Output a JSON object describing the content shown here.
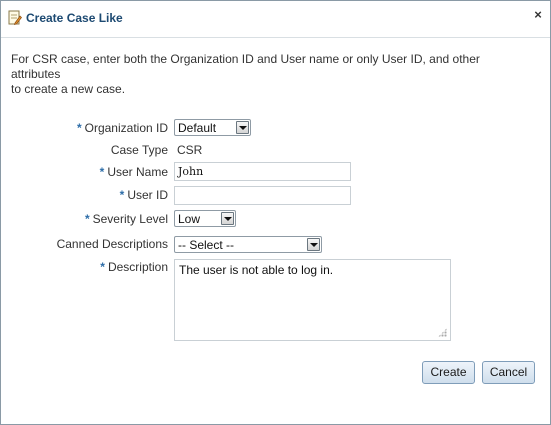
{
  "dialog": {
    "title": "Create Case Like",
    "close_glyph": "×",
    "title_icon": "document-edit-icon",
    "instructions_line1": "For CSR case, enter both the Organization ID and User name or only User ID, and other attributes",
    "instructions_line2": "to create a new case."
  },
  "form": {
    "required_marker": "*",
    "organization_id": {
      "label": "Organization ID",
      "value": "Default"
    },
    "case_type": {
      "label": "Case Type",
      "value": "CSR"
    },
    "user_name": {
      "label": "User Name",
      "value": "John"
    },
    "user_id": {
      "label": "User ID",
      "value": ""
    },
    "severity_level": {
      "label": "Severity Level",
      "value": "Low"
    },
    "canned_descriptions": {
      "label": "Canned Descriptions",
      "value": "-- Select --"
    },
    "description": {
      "label": "Description",
      "value": "The user is not able to log in."
    }
  },
  "buttons": {
    "create": "Create",
    "cancel": "Cancel"
  },
  "colors": {
    "title": "#1d4a72",
    "required": "#2d6da8",
    "button_border": "#7f9db9"
  }
}
